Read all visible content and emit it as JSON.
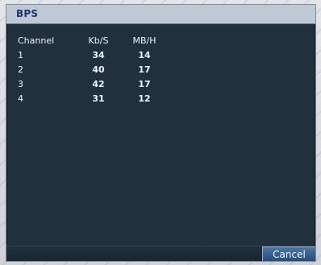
{
  "window": {
    "title": "BPS"
  },
  "table": {
    "columns": [
      "Channel",
      "Kb/S",
      "MB/H"
    ],
    "rows": [
      {
        "channel": "1",
        "kbs": "34",
        "mbh": "14"
      },
      {
        "channel": "2",
        "kbs": "40",
        "mbh": "17"
      },
      {
        "channel": "3",
        "kbs": "42",
        "mbh": "17"
      },
      {
        "channel": "4",
        "kbs": "31",
        "mbh": "12"
      }
    ]
  },
  "footer": {
    "cancel_label": "Cancel"
  },
  "colors": {
    "title_text": "#1a3570",
    "dialog_background": "#20303d",
    "button_background": "#2f5f8f",
    "body_text": "#e7eef7"
  }
}
